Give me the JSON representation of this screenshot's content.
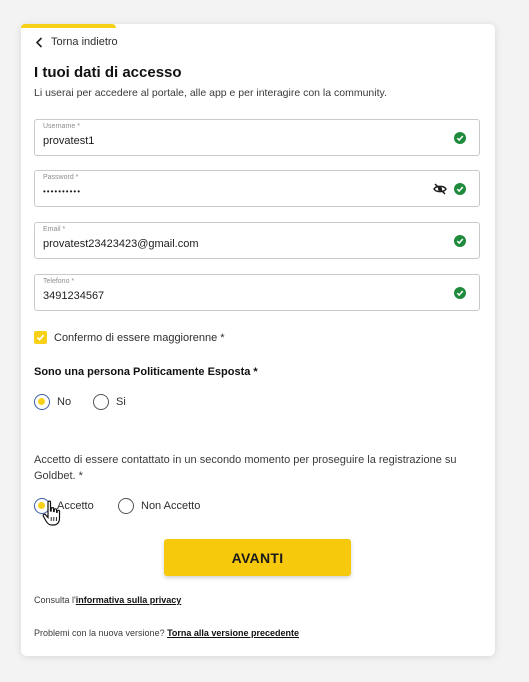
{
  "progress": {
    "fraction": 0.2
  },
  "back_link": {
    "label": "Torna indietro"
  },
  "header": {
    "title": "I tuoi dati di accesso",
    "subtitle": "Li userai per accedere al portale, alle app e per interagire con la community."
  },
  "fields": {
    "username": {
      "label": "Username *",
      "value": "provatest1",
      "valid": true
    },
    "password": {
      "label": "Password *",
      "value": "••••••••••",
      "valid": true
    },
    "email": {
      "label": "Email *",
      "value": "provatest23423423@gmail.com",
      "valid": true
    },
    "phone": {
      "label": "Telefono *",
      "value": "3491234567",
      "valid": true
    }
  },
  "age_confirm": {
    "label": "Confermo di essere maggiorenne *",
    "checked": true
  },
  "pep": {
    "title": "Sono una persona Politicamente Esposta *",
    "options": [
      {
        "label": "No",
        "selected": true
      },
      {
        "label": "Si",
        "selected": false
      }
    ]
  },
  "contact_consent": {
    "text": "Accetto di essere contattato in un secondo momento per proseguire la registrazione su Goldbet. *",
    "options": [
      {
        "label": "Accetto",
        "selected": true
      },
      {
        "label": "Non Accetto",
        "selected": false
      }
    ]
  },
  "submit": {
    "label": "AVANTI"
  },
  "privacy": {
    "prefix": "Consulta l'",
    "link": "informativa sulla privacy"
  },
  "old_version": {
    "prefix": "Problemi con la nuova versione? ",
    "link": "Torna alla versione precedente"
  },
  "colors": {
    "accent": "#f7c90d",
    "valid": "#1f8a3c",
    "radio_ring": "#3b5ea8"
  }
}
